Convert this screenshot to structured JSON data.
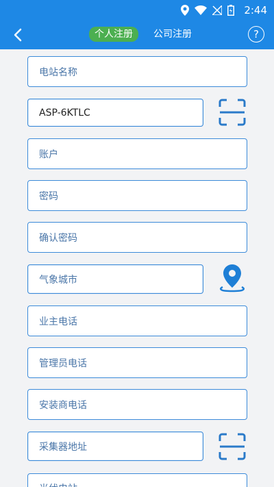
{
  "status": {
    "time": "2:44"
  },
  "tabs": [
    {
      "label": "个人注册",
      "active": true
    },
    {
      "label": "公司注册",
      "active": false
    }
  ],
  "help_label": "?",
  "fields": {
    "station_name": {
      "placeholder": "电站名称"
    },
    "device_sn": {
      "value": "ASP-6KTLC"
    },
    "account": {
      "placeholder": "账户"
    },
    "password": {
      "placeholder": "密码"
    },
    "confirm_password": {
      "placeholder": "确认密码"
    },
    "weather_city": {
      "placeholder": "气象城市"
    },
    "owner_phone": {
      "placeholder": "业主电话"
    },
    "admin_phone": {
      "placeholder": "管理员电话"
    },
    "installer_phone": {
      "placeholder": "安装商电话"
    },
    "collector_address": {
      "placeholder": "采集器地址"
    },
    "solar_power": {
      "placeholder": "光伏电站"
    }
  },
  "colors": {
    "primary": "#1e88e5",
    "active_tab": "#4caf50",
    "border": "#3b8ad9"
  }
}
